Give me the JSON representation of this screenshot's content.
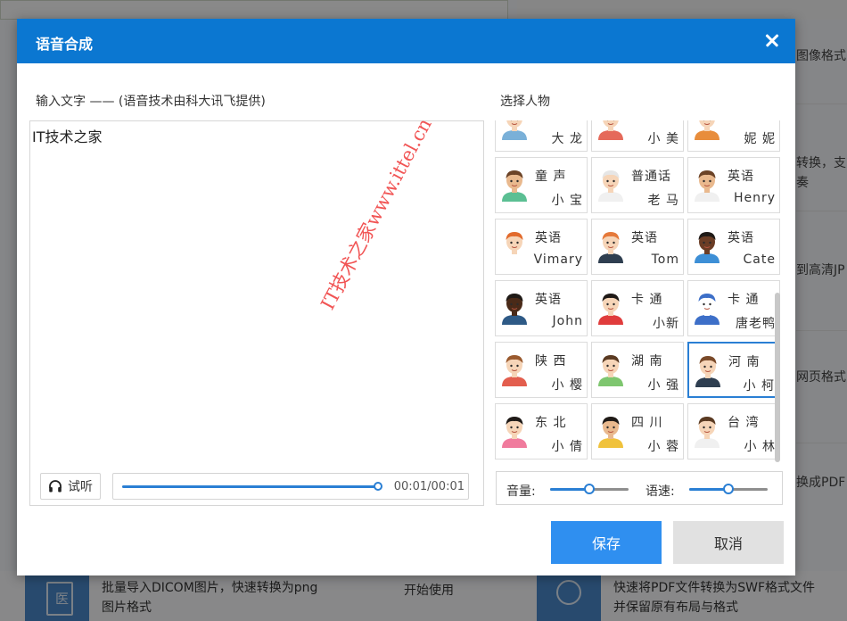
{
  "background": {
    "side_texts": [
      "图像格式",
      "转换，支",
      "奏",
      "到高清JP",
      "网页格式",
      "换成PDF"
    ],
    "bottom_left_text": "批量导入DICOM图片，快速转换为png\n图片格式",
    "bottom_left_icon_text": "医",
    "bottom_mid_text": "开始使用",
    "bottom_right_text": "快速将PDF文件转换为SWF格式文件\n并保留原有布局与格式"
  },
  "dialog": {
    "title": "语音合成",
    "header_color": "#0b77d1",
    "input_label": "输入文字 —— (语音技术由科大讯飞提供)",
    "text_value": "IT技术之家",
    "listen_label": "试听",
    "progress": 0.99,
    "time": "00:01/00:01",
    "voice_label": "选择人物",
    "volume_label": "音量:",
    "volume_level": 0.5,
    "speed_label": "语速:",
    "speed_level": 0.5,
    "save_label": "保存",
    "cancel_label": "取消",
    "accent_color": "#2f8ff0"
  },
  "voices": [
    {
      "line1": "",
      "line2": "大 龙",
      "avatar": "man-blue-shirt-icon"
    },
    {
      "line1": "",
      "line2": "小 美",
      "avatar": "girl-red-icon"
    },
    {
      "line1": "",
      "line2": "妮 妮",
      "avatar": "girl-orange-icon"
    },
    {
      "line1": "童 声",
      "line2": "小 宝",
      "avatar": "boy-green-icon"
    },
    {
      "line1": "普通话",
      "line2": "老 马",
      "avatar": "old-man-glasses-icon"
    },
    {
      "line1": "英语",
      "line2": "Henry",
      "avatar": "bearded-man-icon"
    },
    {
      "line1": "英语",
      "line2": "Vimary",
      "avatar": "redhead-woman-icon"
    },
    {
      "line1": "英语",
      "line2": "Tom",
      "avatar": "redhead-man-icon"
    },
    {
      "line1": "英语",
      "line2": "Cate",
      "avatar": "dark-skin-woman-icon"
    },
    {
      "line1": "英语",
      "line2": "John",
      "avatar": "dark-skin-bearded-man-icon"
    },
    {
      "line1": "卡 通",
      "line2": "小新",
      "avatar": "cartoon-boy-icon"
    },
    {
      "line1": "卡 通",
      "line2": "唐老鸭",
      "avatar": "cartoon-duck-icon"
    },
    {
      "line1": "陕 西",
      "line2": "小 樱",
      "avatar": "brown-hair-girl-icon"
    },
    {
      "line1": "湖 南",
      "line2": "小 强",
      "avatar": "young-man-green-icon"
    },
    {
      "line1": "河 南",
      "line2": "小 柯",
      "avatar": "man-bowtie-icon"
    },
    {
      "line1": "东 北",
      "line2": "小 倩",
      "avatar": "black-hair-woman-icon"
    },
    {
      "line1": "四 川",
      "line2": "小 蓉",
      "avatar": "woman-flower-hair-icon"
    },
    {
      "line1": "台 湾",
      "line2": "小 林",
      "avatar": "long-hair-woman-icon"
    }
  ],
  "selected_voice": 14,
  "watermark": "IT技术之家www.ittel.cn"
}
